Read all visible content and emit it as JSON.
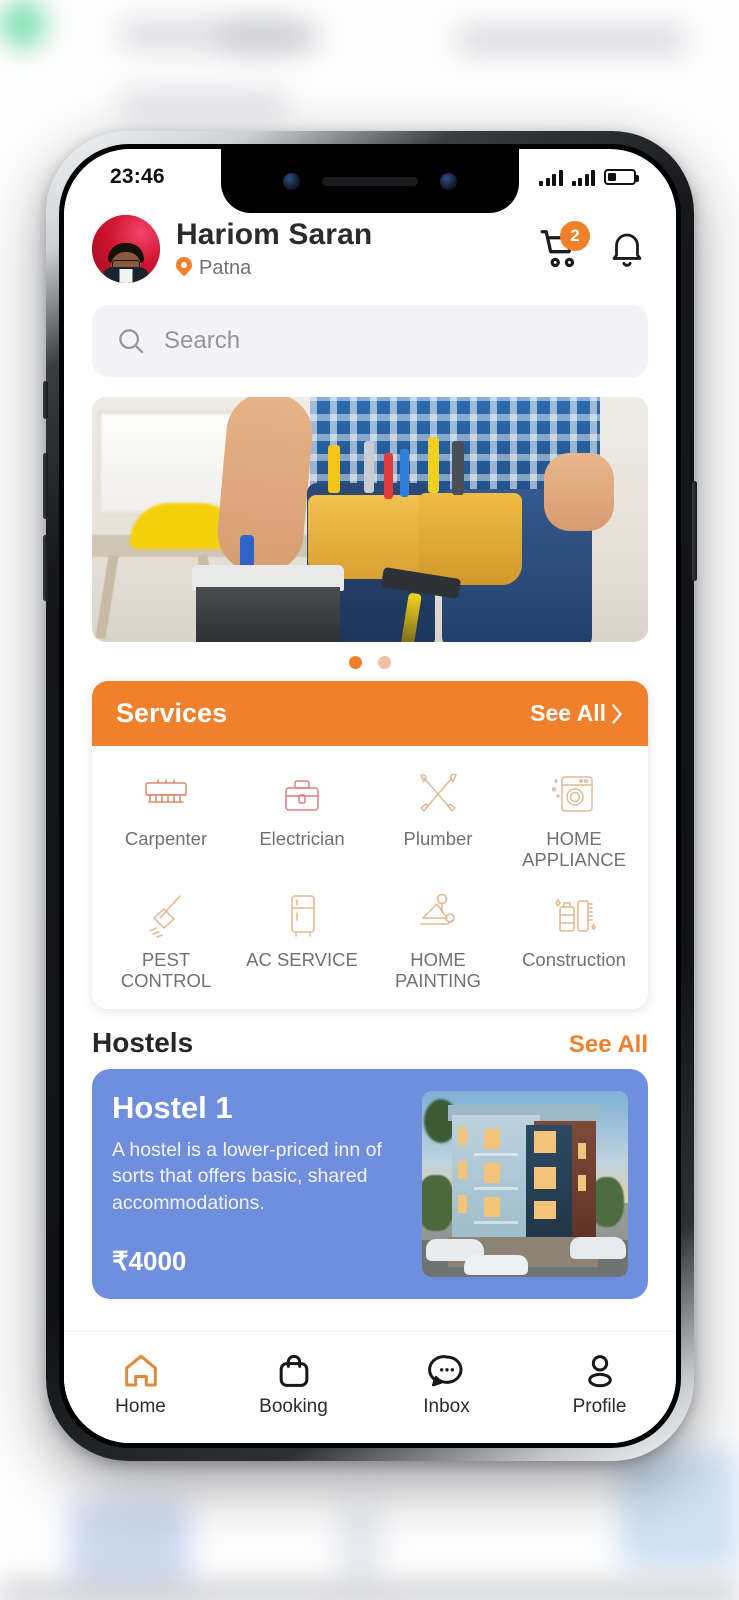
{
  "status_bar": {
    "time": "23:46",
    "battery_level_pct": 34
  },
  "header": {
    "user_name": "Hariom Saran",
    "location": "Patna",
    "location_icon": "map-pin-icon",
    "cart_icon": "shopping-cart-icon",
    "cart_badge_count": "2",
    "notification_icon": "bell-icon",
    "avatar_alt": "user-avatar"
  },
  "search": {
    "placeholder": "Search",
    "icon": "search-icon",
    "value": ""
  },
  "banner": {
    "alt": "handyman-with-tool-belt-and-toolbox",
    "carousel_dots": 2,
    "active_dot_index": 0,
    "active_dot_color": "#f0802a",
    "inactive_dot_color": "#f0c0a8"
  },
  "services": {
    "title": "Services",
    "see_all_label": "See All",
    "see_all_chevron": "chevron-right-icon",
    "header_color": "#f0802a",
    "items": [
      {
        "label": "Carpenter",
        "icon": "saw-icon"
      },
      {
        "label": "Electrician",
        "icon": "toolbox-icon"
      },
      {
        "label": "Plumber",
        "icon": "crossed-tools-icon"
      },
      {
        "label": "HOME APPLIANCE",
        "icon": "washing-machine-icon"
      },
      {
        "label": "PEST CONTROL",
        "icon": "broom-icon"
      },
      {
        "label": "AC SERVICE",
        "icon": "refrigerator-icon"
      },
      {
        "label": "HOME PAINTING",
        "icon": "paint-roller-icon"
      },
      {
        "label": "Construction",
        "icon": "construction-tools-icon"
      }
    ]
  },
  "hostels": {
    "title": "Hostels",
    "see_all_label": "See All",
    "see_all_color": "#f0802a",
    "card": {
      "name": "Hostel 1",
      "description": "A hostel is a lower-priced inn of sorts that offers basic, shared accommodations.",
      "price": "₹4000",
      "image_alt": "three-story-hostel-building",
      "background_color": "#6f8ede"
    }
  },
  "bottom_nav": {
    "active_color": "#e08a3c",
    "items": [
      {
        "label": "Home",
        "icon": "home-icon",
        "active": true
      },
      {
        "label": "Booking",
        "icon": "bag-icon",
        "active": false
      },
      {
        "label": "Inbox",
        "icon": "chat-icon",
        "active": false
      },
      {
        "label": "Profile",
        "icon": "person-icon",
        "active": false
      }
    ]
  }
}
